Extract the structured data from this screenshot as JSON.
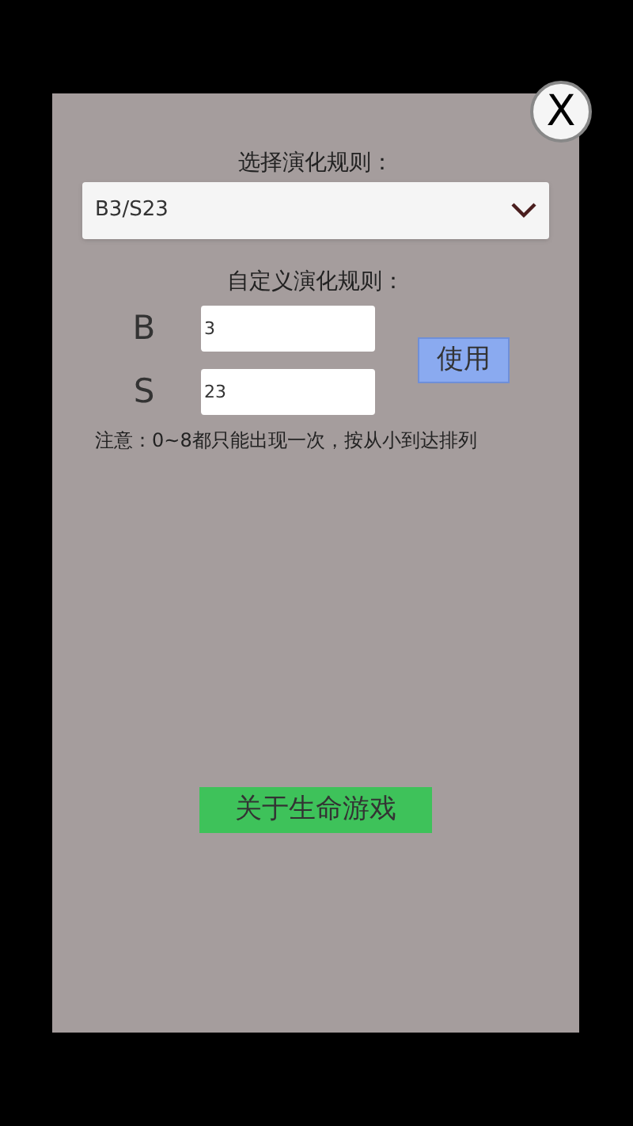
{
  "close_button": {
    "label": "X"
  },
  "rule_select": {
    "title": "选择演化规则：",
    "value": "B3/S23"
  },
  "custom_rule": {
    "title": "自定义演化规则：",
    "fields": [
      {
        "label": "B",
        "value": "3"
      },
      {
        "label": "S",
        "value": "23"
      }
    ],
    "apply_button": "使用",
    "note": "注意：0~8都只能出现一次，按从小到达排列"
  },
  "about_button": "关于生命游戏"
}
